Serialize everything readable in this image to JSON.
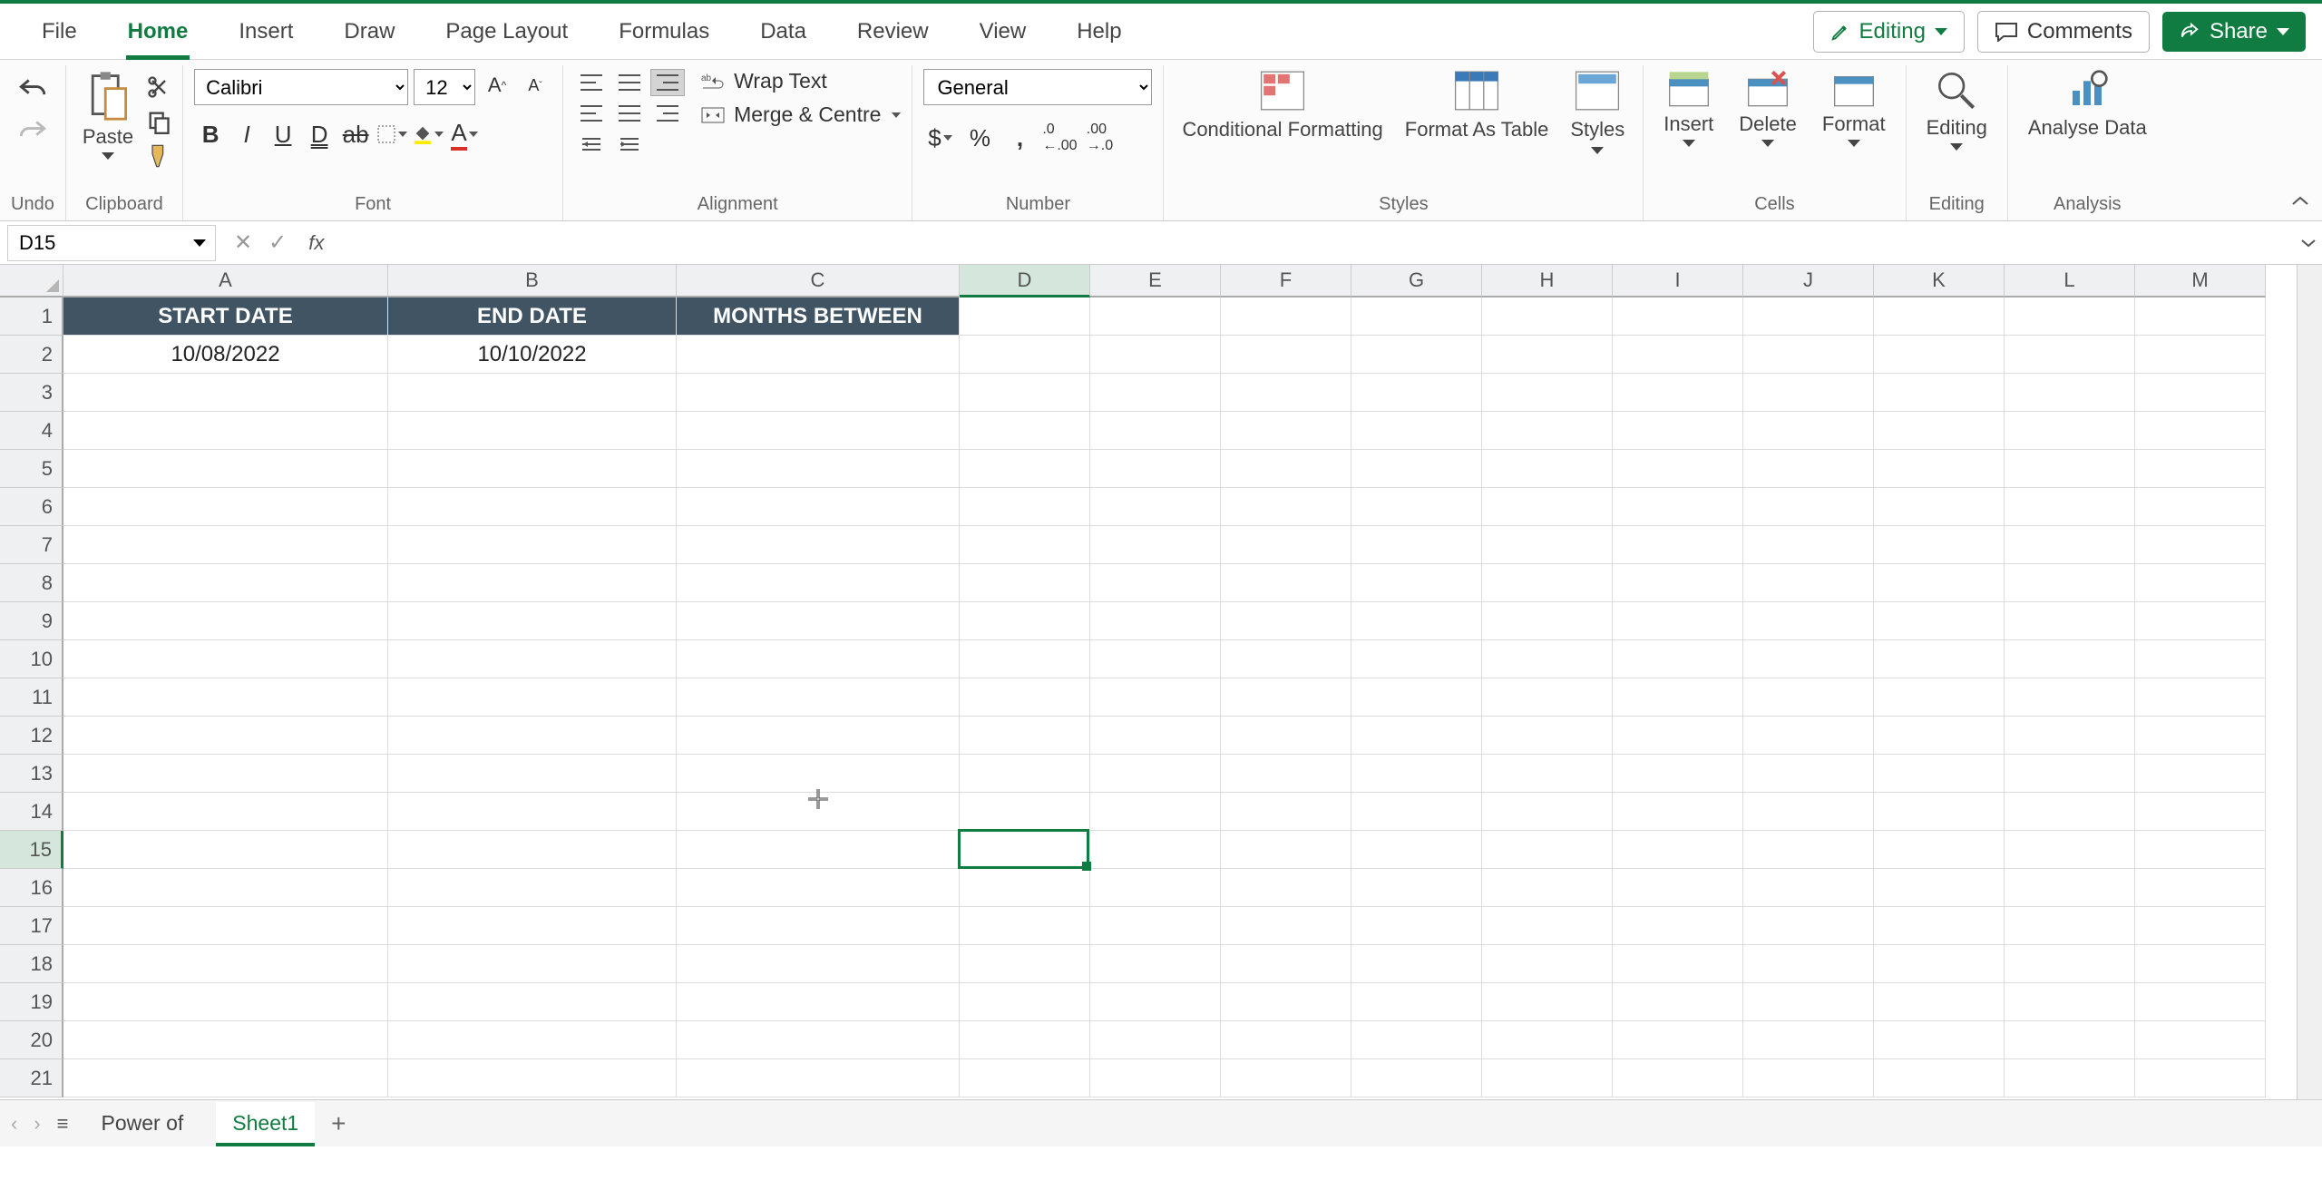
{
  "tabs": {
    "file": "File",
    "home": "Home",
    "insert": "Insert",
    "draw": "Draw",
    "page_layout": "Page Layout",
    "formulas": "Formulas",
    "data": "Data",
    "review": "Review",
    "view": "View",
    "help": "Help"
  },
  "topright": {
    "editing": "Editing",
    "comments": "Comments",
    "share": "Share"
  },
  "ribbon": {
    "undo": "Undo",
    "clipboard": "Clipboard",
    "paste": "Paste",
    "font_group": "Font",
    "font_name": "Calibri",
    "font_size": "12",
    "alignment": "Alignment",
    "wrap": "Wrap Text",
    "merge": "Merge & Centre",
    "number": "Number",
    "number_format": "General",
    "styles": "Styles",
    "cond_fmt": "Conditional Formatting",
    "fmt_table": "Format As Table",
    "styles_btn": "Styles",
    "cells": "Cells",
    "insert": "Insert",
    "delete": "Delete",
    "format": "Format",
    "editing_group": "Editing",
    "editing_btn": "Editing",
    "analysis": "Analysis",
    "analyse": "Analyse Data"
  },
  "namebox": "D15",
  "formula": "",
  "columns": [
    "A",
    "B",
    "C",
    "D",
    "E",
    "F",
    "G",
    "H",
    "I",
    "J",
    "K",
    "L",
    "M"
  ],
  "col_widths": {
    "A": 358,
    "B": 318,
    "C": 312,
    "D": 144,
    "E": 144,
    "F": 144,
    "G": 144,
    "H": 144,
    "I": 144,
    "J": 144,
    "K": 144,
    "L": 144,
    "M": 144
  },
  "rows": [
    "1",
    "2",
    "3",
    "4",
    "5",
    "6",
    "7",
    "8",
    "9",
    "10",
    "11",
    "12",
    "13",
    "14",
    "15",
    "16",
    "17",
    "18",
    "19",
    "20",
    "21"
  ],
  "data": {
    "A1": "START DATE",
    "B1": "END DATE",
    "C1": "MONTHS BETWEEN",
    "A2": "10/08/2022",
    "B2": "10/10/2022"
  },
  "active_cell": "D15",
  "sheets": {
    "power": "Power of",
    "sheet1": "Sheet1"
  }
}
